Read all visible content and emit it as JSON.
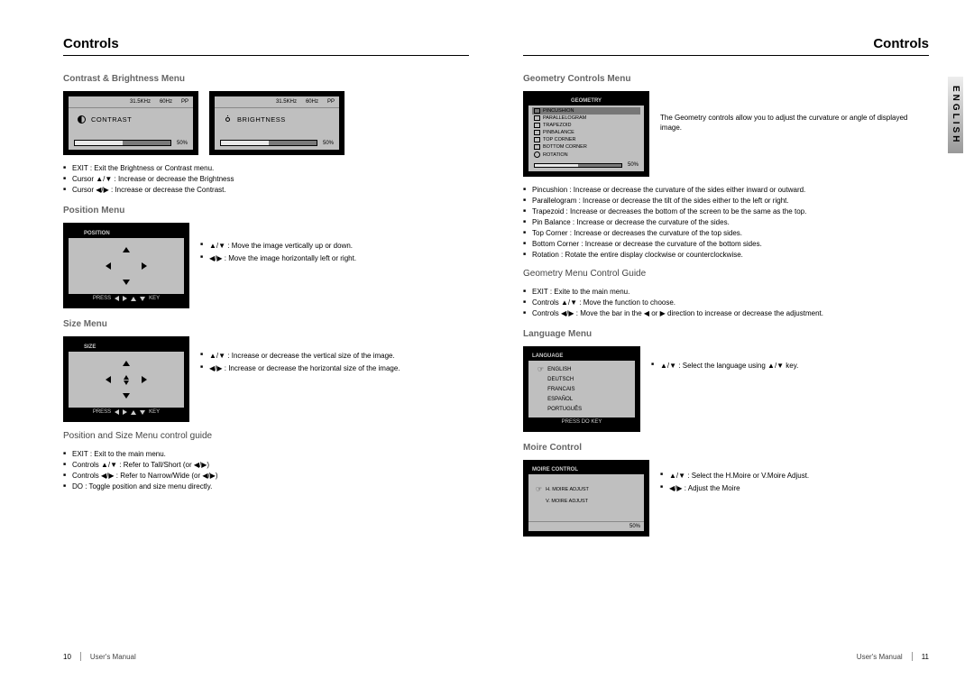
{
  "header": {
    "left": "Controls",
    "right": "Controls"
  },
  "english_tab": "ENGLISH",
  "contrast_menu": {
    "title": "Contrast & Brightness Menu",
    "topbar": {
      "freq": "31.5KHz",
      "refresh": "60Hz",
      "mode": "PP"
    },
    "contrast_label": "CONTRAST",
    "brightness_label": "BRIGHTNESS",
    "pct": "50%",
    "notes": [
      "EXIT : Exit the Brightness or Contrast menu.",
      "Cursor ▲/▼ : Increase or decrease the Brightness",
      "Cursor ◀/▶ : Increase or decrease the Contrast."
    ]
  },
  "position_menu": {
    "title": "Position Menu",
    "label": "POSITION",
    "press": "PRESS",
    "key": "KEY",
    "notes": [
      "▲/▼ : Move the image vertically up or down.",
      "◀/▶ : Move the image horizontally left or right."
    ]
  },
  "size_menu": {
    "title": "Size Menu",
    "label": "SIZE",
    "press": "PRESS",
    "key": "KEY",
    "notes": [
      "▲/▼ : Increase or decrease the vertical size of the image.",
      "◀/▶ : Increase or decrease the horizontal size of the image."
    ]
  },
  "pos_size_guide": {
    "title": "Position and Size Menu control guide",
    "notes": [
      "EXIT : Exit to the main menu.",
      "Controls ▲/▼ : Refer to Tall/Short (or ◀/▶)",
      "Controls ◀/▶ : Refer to Narrow/Wide (or ◀/▶)",
      "DO : Toggle position and size menu directly."
    ]
  },
  "geometry_menu": {
    "title": "Geometry Controls Menu",
    "header": "GEOMETRY",
    "items": [
      "PINCUSHION",
      "PARALLELOGRAM",
      "TRAPEZOID",
      "PINBALANCE",
      "TOP CORNER",
      "BOTTOM CORNER",
      "ROTATION"
    ],
    "pct": "50%",
    "desc": "The Geometry controls allow you to adjust the curvature or angle of displayed image.",
    "notes": [
      "Pincushion : Increase or decrease the curvature of the sides either inward or outward.",
      "Parallelogram : Increase or decrease the tilt of the sides either to the left or right.",
      "Trapezoid : Increase or decreases the bottom of the screen to be the same as the top.",
      "Pin Balance : Increase or decrease the curvature of the sides.",
      "Top Corner : Increase or decreases the curvature of the top sides.",
      "Bottom Corner : Increase or decrease the curvature of the bottom sides.",
      "Rotation : Rotate the entire display clockwise or counterclockwise."
    ]
  },
  "geometry_guide": {
    "title": "Geometry Menu Control Guide",
    "notes": [
      "EXIT : Exite to the main menu.",
      "Controls ▲/▼ : Move the function to choose.",
      "Controls ◀/▶ : Move the bar in the ◀ or ▶ direction to increase or decrease the adjustment."
    ]
  },
  "language_menu": {
    "title": "Language Menu",
    "header": "LANGUAGE",
    "items": [
      "ENGLISH",
      "DEUTSCH",
      "FRANCAIS",
      "ESPAÑOL",
      "PORTUGUÊS"
    ],
    "footer": "PRESS DO KEY",
    "note": "▲/▼ : Select the language using ▲/▼ key."
  },
  "moire_menu": {
    "title": "Moire Control",
    "header": "MOIRE CONTROL",
    "h_label": "H. MOIRE ADJUST",
    "v_label": "V. MOIRE ADJUST",
    "pct": "50%",
    "notes": [
      "▲/▼ : Select the H.Moire or V.Moire Adjust.",
      "◀/▶ : Adjust the Moire"
    ]
  },
  "footer": {
    "left_num": "10",
    "right_num": "11",
    "manual": "User's Manual"
  }
}
